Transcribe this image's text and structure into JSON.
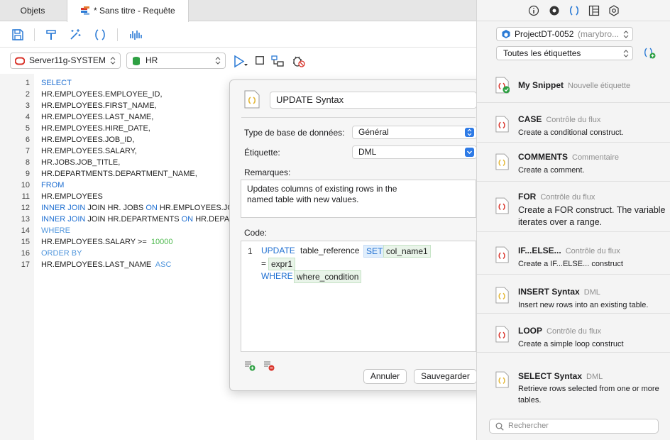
{
  "tabs": {
    "objets": "Objets",
    "query": "* Sans titre - Requête"
  },
  "connection": {
    "server": "Server11g-SYSTEM",
    "schema": "HR"
  },
  "editor": {
    "line_numbers": [
      "1",
      "2",
      "3",
      "4",
      "5",
      "6",
      "7",
      "8",
      "9",
      "10",
      "11",
      "12",
      "13",
      "14",
      "15",
      "16",
      "17"
    ],
    "lines": [
      [
        {
          "t": "SELECT",
          "c": "kw"
        }
      ],
      [
        {
          "t": "HR.EMPLOYEES.EMPLOYEE_ID,",
          "c": ""
        }
      ],
      [
        {
          "t": "HR.EMPLOYEES.FIRST_NAME,",
          "c": ""
        }
      ],
      [
        {
          "t": "HR.EMPLOYEES.LAST_NAME,",
          "c": ""
        }
      ],
      [
        {
          "t": "HR.EMPLOYEES.HIRE_DATE,",
          "c": ""
        }
      ],
      [
        {
          "t": "HR.EMPLOYEES.JOB_ID,",
          "c": ""
        }
      ],
      [
        {
          "t": "HR.EMPLOYEES.SALARY,",
          "c": ""
        }
      ],
      [
        {
          "t": "HR.JOBS.JOB_TITLE,",
          "c": ""
        }
      ],
      [
        {
          "t": "HR.DEPARTMENTS.DEPARTMENT_NAME,",
          "c": ""
        }
      ],
      [
        {
          "t": "FROM",
          "c": "kw"
        }
      ],
      [
        {
          "t": "HR.EMPLOYEES",
          "c": ""
        }
      ],
      [
        {
          "t": "INNER JOIN ",
          "c": "kw"
        },
        {
          "t": "JOIN HR. JOBS ",
          "c": ""
        },
        {
          "t": "ON ",
          "c": "kw"
        },
        {
          "t": "HR.EMPLOYEES.JOB",
          "c": ""
        }
      ],
      [
        {
          "t": "INNER JOIN ",
          "c": "kw"
        },
        {
          "t": "JOIN HR.DEPARTMENTS ",
          "c": ""
        },
        {
          "t": "ON ",
          "c": "kw"
        },
        {
          "t": "HR.DEPAR",
          "c": ""
        }
      ],
      [
        {
          "t": "WHERE",
          "c": "kw2"
        }
      ],
      [
        {
          "t": "HR.EMPLOYEES.SALARY >=  ",
          "c": ""
        },
        {
          "t": "10000",
          "c": "num"
        }
      ],
      [
        {
          "t": "ORDER BY",
          "c": "kw2"
        }
      ],
      [
        {
          "t": "HR.EMPLOYEES.LAST_NAME  ",
          "c": ""
        },
        {
          "t": "ASC",
          "c": "kw2"
        }
      ]
    ]
  },
  "snippet_editor": {
    "name": "UPDATE Syntax",
    "db_type_label": "Type de base de données:",
    "db_type_value": "Général",
    "tag_label": "Étiquette:",
    "tag_value": "DML",
    "remarks_label": "Remarques:",
    "remarks": "Updates columns of existing rows in the\nnamed table with new values.",
    "code_label": "Code:",
    "code_line_number": "1",
    "code_tokens": {
      "update": "UPDATE",
      "table_reference": "table_reference",
      "set": "SET",
      "col_name1": "col_name1",
      "equals": "=",
      "expr1": "expr1",
      "where": "WHERE",
      "where_condition": "where_condition"
    },
    "cancel": "Annuler",
    "save": "Sauvegarder"
  },
  "snippet_panel": {
    "project": "ProjectDT-0052",
    "project_user": "(marybro...",
    "tags_filter": "Toutes les étiquettes",
    "search_placeholder": "Rechercher",
    "snippets": [
      {
        "name": "My Snippet",
        "tag": "Nouvelle étiquette",
        "desc": ""
      },
      {
        "name": "CASE",
        "tag": "Contrôle du flux",
        "desc": "Create a conditional construct."
      },
      {
        "name": "COMMENTS",
        "tag": "Commentaire",
        "desc": "Create a comment."
      },
      {
        "name": "FOR",
        "tag": "Contrôle du flux",
        "desc": "Create a FOR construct. The variable iterates over a range."
      },
      {
        "name": "IF...ELSE...",
        "tag": "Contrôle du flux",
        "desc": "Create a IF...ELSE... construct"
      },
      {
        "name": "INSERT Syntax",
        "tag": "DML",
        "desc": "Insert new rows into an existing table."
      },
      {
        "name": "LOOP",
        "tag": "Contrôle du flux",
        "desc": "Create a simple loop construct"
      },
      {
        "name": "SELECT Syntax",
        "tag": "DML",
        "desc": "Retrieve rows selected from one or more tables."
      }
    ]
  },
  "colors": {
    "accent": "#2a7ad5",
    "keyword": "#1f6fd1",
    "number": "#4cb84c",
    "snippet_red": "#d9342b",
    "snippet_yellow": "#e3b634"
  }
}
